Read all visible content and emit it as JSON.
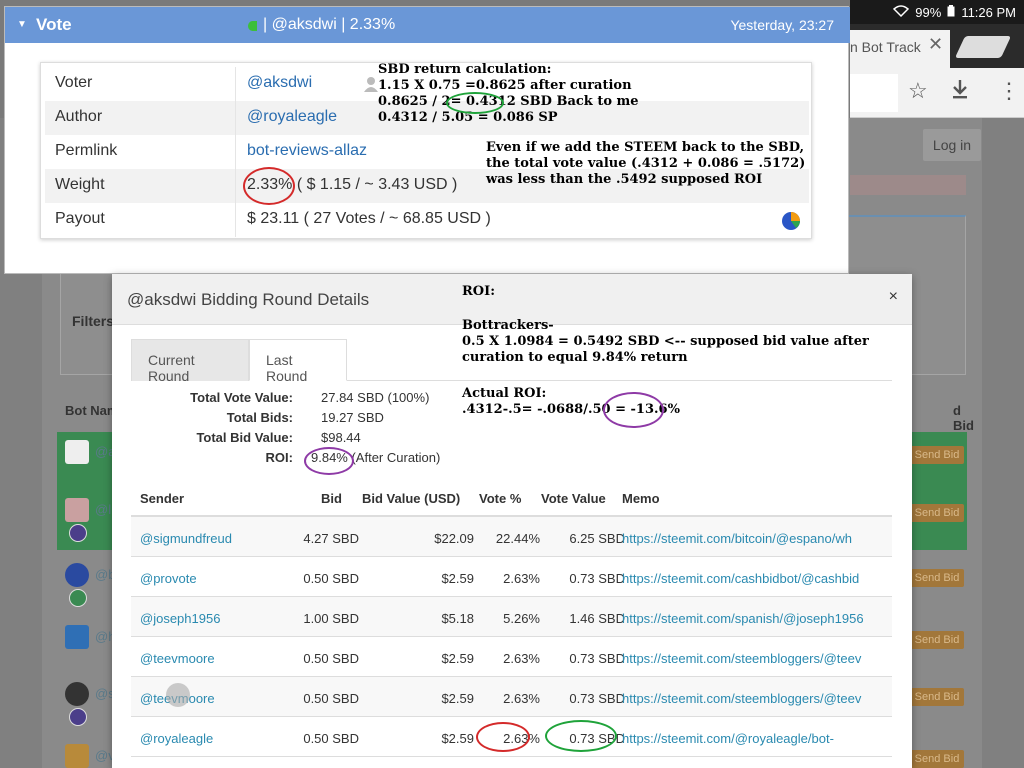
{
  "status_bar": {
    "wifi_icon": "wifi-icon",
    "battery": "99%",
    "time": "11:26 PM"
  },
  "browser": {
    "tab_title": "n Bot Track",
    "close": "✕"
  },
  "background_page": {
    "login": "Log in",
    "filters": "Filters",
    "bot_name_header": "Bot Nam",
    "bid_header": "d Bid",
    "rows": [
      {
        "name": "@a",
        "send": "Send Bid"
      },
      {
        "name": "@l",
        "send": "Send Bid"
      },
      {
        "name": "@b",
        "send": "Send Bid"
      },
      {
        "name": "@h",
        "send": "Send Bid"
      },
      {
        "name": "@s",
        "send": "Send Bid"
      },
      {
        "name": "@v",
        "send": "Send Bid"
      }
    ]
  },
  "vote_popup": {
    "title": "Vote",
    "summary": "| @aksdwi | 2.33%",
    "time": "Yesterday, 23:27",
    "rows": [
      {
        "key": "Voter",
        "value": "@aksdwi"
      },
      {
        "key": "Author",
        "value": "@royaleagle"
      },
      {
        "key": "Permlink",
        "value": "bot-reviews-allaz"
      },
      {
        "key": "Weight",
        "value": "2.33% ( $ 1.15 / ~ 3.43 USD )"
      },
      {
        "key": "Payout",
        "value": "$ 23.11 ( 27 Votes / ~ 68.85 USD )"
      }
    ]
  },
  "annotations": {
    "sbd_calc": [
      "SBD return calculation:",
      "1.15 X 0.75 =0.8625 after curation",
      "0.8625 / 2= 0.4312 SBD Back to me",
      "0.4312 / 5.05 = 0.086 SP"
    ],
    "steem_note": [
      "Even if we add the STEEM back to the SBD,",
      "the total vote value (.4312 + 0.086 = .5172)",
      "was less than the .5492 supposed ROI"
    ],
    "roi_heading": "ROI:",
    "bottrackers": [
      "Bottrackers-",
      "0.5 X 1.0984 = 0.5492 SBD  <-- supposed bid value after",
      "curation to equal 9.84% return"
    ],
    "actual_roi": [
      "Actual ROI:",
      ".4312-.5= -.0688/.50 = -13.6%"
    ],
    "ring_colors": {
      "green": "#1fa33a",
      "red": "#d42a2a",
      "purple": "#8e3aa6"
    }
  },
  "bidding_modal": {
    "title": "@aksdwi Bidding Round Details",
    "close": "×",
    "tabs": [
      "Current Round",
      "Last Round"
    ],
    "active_tab": "Last Round",
    "summary": [
      {
        "label": "Total Vote Value:",
        "value": "27.84 SBD (100%)"
      },
      {
        "label": "Total Bids:",
        "value": "19.27 SBD"
      },
      {
        "label": "Total Bid Value:",
        "value": "$98.44"
      },
      {
        "label": "ROI:",
        "value": "9.84% (After Curation)"
      }
    ],
    "columns": [
      "Sender",
      "Bid",
      "Bid Value (USD)",
      "Vote %",
      "Vote Value",
      "Memo"
    ],
    "rows": [
      {
        "sender": "@sigmundfreud",
        "bid": "4.27 SBD",
        "bid_usd": "$22.09",
        "vote_pct": "22.44%",
        "vote_value": "6.25 SBD",
        "memo": "https://steemit.com/bitcoin/@espano/wh"
      },
      {
        "sender": "@provote",
        "bid": "0.50 SBD",
        "bid_usd": "$2.59",
        "vote_pct": "2.63%",
        "vote_value": "0.73 SBD",
        "memo": "https://steemit.com/cashbidbot/@cashbid"
      },
      {
        "sender": "@joseph1956",
        "bid": "1.00 SBD",
        "bid_usd": "$5.18",
        "vote_pct": "5.26%",
        "vote_value": "1.46 SBD",
        "memo": "https://steemit.com/spanish/@joseph1956"
      },
      {
        "sender": "@teevmoore",
        "bid": "0.50 SBD",
        "bid_usd": "$2.59",
        "vote_pct": "2.63%",
        "vote_value": "0.73 SBD",
        "memo": "https://steemit.com/steembloggers/@teev"
      },
      {
        "sender": "@teevmoore",
        "bid": "0.50 SBD",
        "bid_usd": "$2.59",
        "vote_pct": "2.63%",
        "vote_value": "0.73 SBD",
        "memo": "https://steemit.com/steembloggers/@teev"
      },
      {
        "sender": "@royaleagle",
        "bid": "0.50 SBD",
        "bid_usd": "$2.59",
        "vote_pct": "2.63%",
        "vote_value": "0.73 SBD",
        "memo": "https://steemit.com/@royaleagle/bot-"
      }
    ]
  }
}
